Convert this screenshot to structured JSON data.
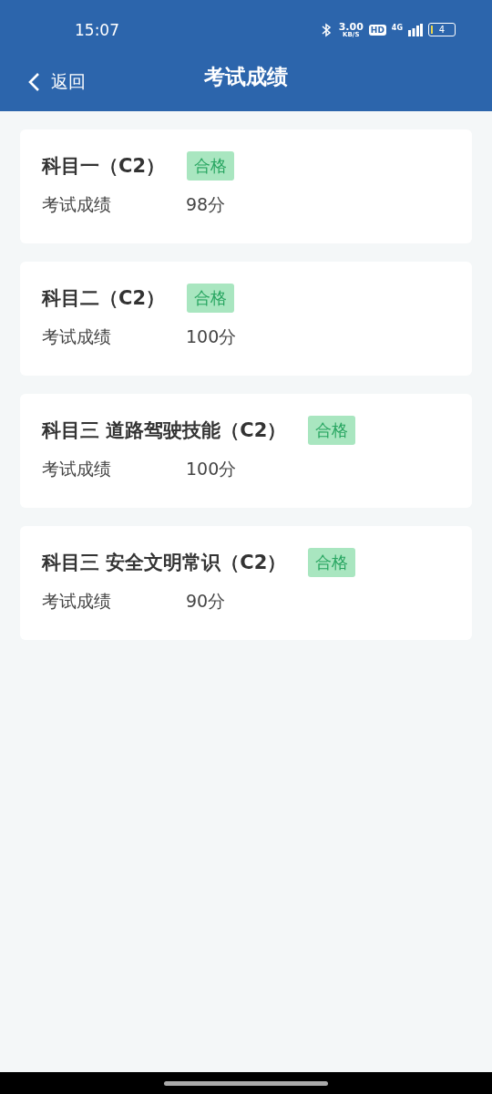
{
  "status_bar": {
    "time": "15:07",
    "speed": "3.00",
    "speed_unit": "KB/S",
    "hd": "HD",
    "network": "4G",
    "battery": "4"
  },
  "nav": {
    "back": "返回",
    "title": "考试成绩"
  },
  "results": [
    {
      "subject": "科目一（C2）",
      "badge": "合格",
      "label": "考试成绩",
      "score": "98分"
    },
    {
      "subject": "科目二（C2）",
      "badge": "合格",
      "label": "考试成绩",
      "score": "100分"
    },
    {
      "subject": "科目三 道路驾驶技能（C2）",
      "badge": "合格",
      "label": "考试成绩",
      "score": "100分"
    },
    {
      "subject": "科目三 安全文明常识（C2）",
      "badge": "合格",
      "label": "考试成绩",
      "score": "90分"
    }
  ]
}
